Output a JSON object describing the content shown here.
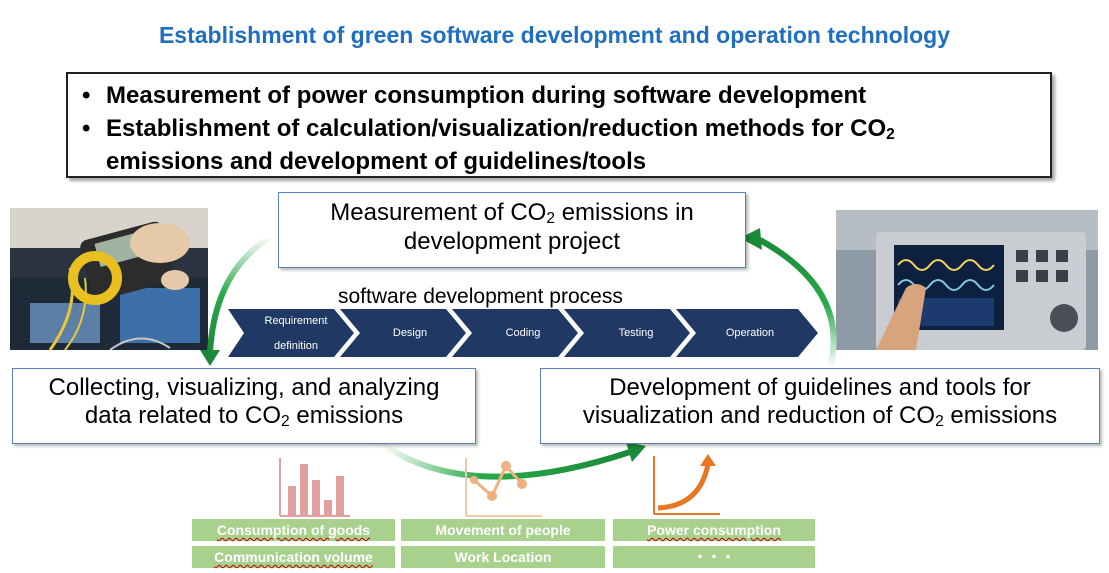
{
  "title": "Establishment of green software development and operation technology",
  "bullets": {
    "line1": "Measurement of power consumption during software development",
    "line2a": "Establishment of calculation/visualization/reduction methods for CO",
    "line2_sub": "2",
    "line2b": "emissions and development of guidelines/tools"
  },
  "top_box": {
    "line1_pre": "Measurement of CO",
    "sub": "2",
    "line1_post": " emissions in",
    "line2": "development project"
  },
  "process_label": "software development process",
  "process_steps": [
    "Requirement",
    "definition",
    "Design",
    "Coding",
    "Testing",
    "Operation"
  ],
  "left_box": {
    "line1": "Collecting, visualizing, and analyzing",
    "line2_pre": "data related to CO",
    "sub": "2",
    "line2_post": " emissions"
  },
  "right_box": {
    "line1": "Development of guidelines and tools for",
    "line2_pre": "visualization and reduction of CO",
    "sub": "2",
    "line2_post": " emissions"
  },
  "tags": {
    "col1": [
      "Consumption of goods",
      "Communication volume"
    ],
    "col2": [
      "Movement of people",
      "Work Location"
    ],
    "col3": [
      "Power consumption",
      "・・・"
    ]
  },
  "colors": {
    "title": "#1f6fc1",
    "chevron": "#1f3864",
    "arrow_green": "#1a9a3a",
    "tag_green": "#a9d18e",
    "bar_red": "#e0a0a0",
    "line_orange": "#f0b080",
    "curve_orange": "#e87722"
  }
}
